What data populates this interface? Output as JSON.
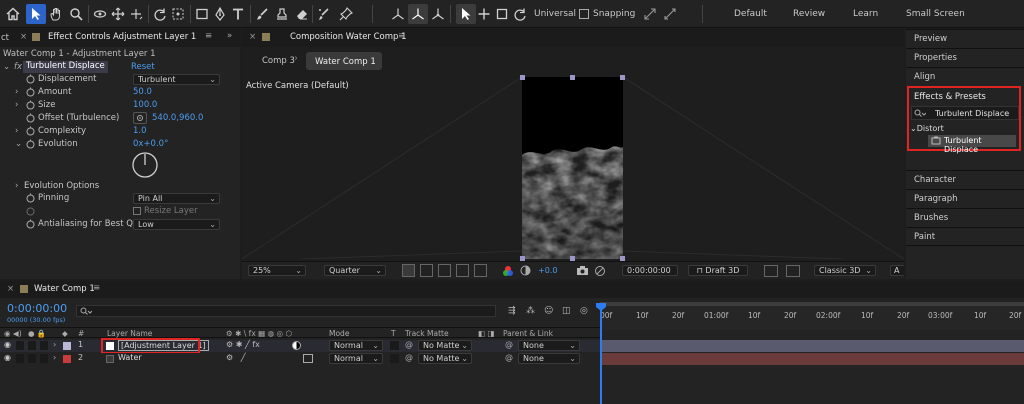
{
  "toolbar": {
    "tools": [
      "home-icon",
      "selection-tool-icon",
      "hand-tool-icon",
      "zoom-tool-icon",
      "orbit-tool-icon",
      "pan-behind-tool-icon",
      "pan-tool-icon",
      "rotate-tool-icon",
      "anchor-tool-icon",
      "rectangle-tool-icon",
      "pen-tool-icon",
      "type-tool-icon",
      "brush-tool-icon",
      "clone-stamp-icon",
      "eraser-icon",
      "roto-brush-icon",
      "puppet-pin-icon"
    ],
    "axis_mode": "Universal",
    "snapping": "Snapping",
    "workspaces": [
      "Default",
      "Review",
      "Learn",
      "Small Screen"
    ]
  },
  "effect_controls": {
    "tab_prefix": "ct",
    "tab_title": "Effect Controls Adjustment Layer 1",
    "layer_path": "Water Comp 1 - Adjustment Layer 1",
    "effect_name": "Turbulent Displace",
    "reset": "Reset",
    "properties": [
      {
        "name": "Displacement",
        "value": "Turbulent",
        "kind": "dropdown"
      },
      {
        "name": "Amount",
        "value": "50.0",
        "kind": "value"
      },
      {
        "name": "Size",
        "value": "100.0",
        "kind": "value"
      },
      {
        "name": "Offset (Turbulence)",
        "value": "540.0,960.0",
        "kind": "point"
      },
      {
        "name": "Complexity",
        "value": "1.0",
        "kind": "value"
      },
      {
        "name": "Evolution",
        "value": "0x+0.0°",
        "kind": "value"
      }
    ],
    "evolution_options": "Evolution Options",
    "pinning_label": "Pinning",
    "pinning_value": "Pin All",
    "resize_layer": "Resize Layer",
    "antialias_label": "Antialiasing for Best Quali",
    "antialias_value": "Low"
  },
  "composition": {
    "tab_title": "Composition Water Comp 1",
    "breadcrumbs": [
      "Comp 3",
      "Water Comp 1"
    ],
    "camera_label": "Active Camera (Default)",
    "zoom": "25%",
    "resolution": "Quarter",
    "exposure": "+0.0",
    "timecode": "0:00:00:00",
    "renderer": "Draft 3D",
    "renderer3d": "Classic 3D",
    "extra": "A"
  },
  "right_panels": {
    "items_top": [
      "Preview",
      "Properties",
      "Align"
    ],
    "effects_title": "Effects & Presets",
    "search_value": "Turbulent Displace",
    "category": "Distort",
    "result": "Turbulent Displace",
    "items_bottom": [
      "Character",
      "Paragraph",
      "Brushes",
      "Paint"
    ]
  },
  "timeline": {
    "tab_title": "Water Comp 1",
    "timecode": "0:00:00:00",
    "fps": "00000 (30.00 fps)",
    "headers": {
      "layer_name": "Layer Name",
      "num": "#",
      "mode": "Mode",
      "t": "T",
      "track_matte": "Track Matte",
      "parent": "Parent & Link"
    },
    "ruler": [
      "00f",
      "10f",
      "20f",
      "01:00f",
      "10f",
      "20f",
      "02:00f",
      "10f",
      "20f",
      "03:00f",
      "10f",
      "20f"
    ],
    "layers": [
      {
        "num": "1",
        "name": "[Adjustment Layer 1]",
        "color": "#b9b9d7",
        "mode": "Normal",
        "matte": "No Matte",
        "parent": "None"
      },
      {
        "num": "2",
        "name": "Water",
        "color": "#c83c3c",
        "mode": "Normal",
        "matte": "No Matte",
        "parent": "None"
      }
    ]
  },
  "colors": {
    "accent": "#2d64c9",
    "highlight_red": "#e02424",
    "timecode_blue": "#4d9cf0",
    "layer1_bar": "#5a5a6e",
    "layer2_bar": "#6b3a3a"
  }
}
